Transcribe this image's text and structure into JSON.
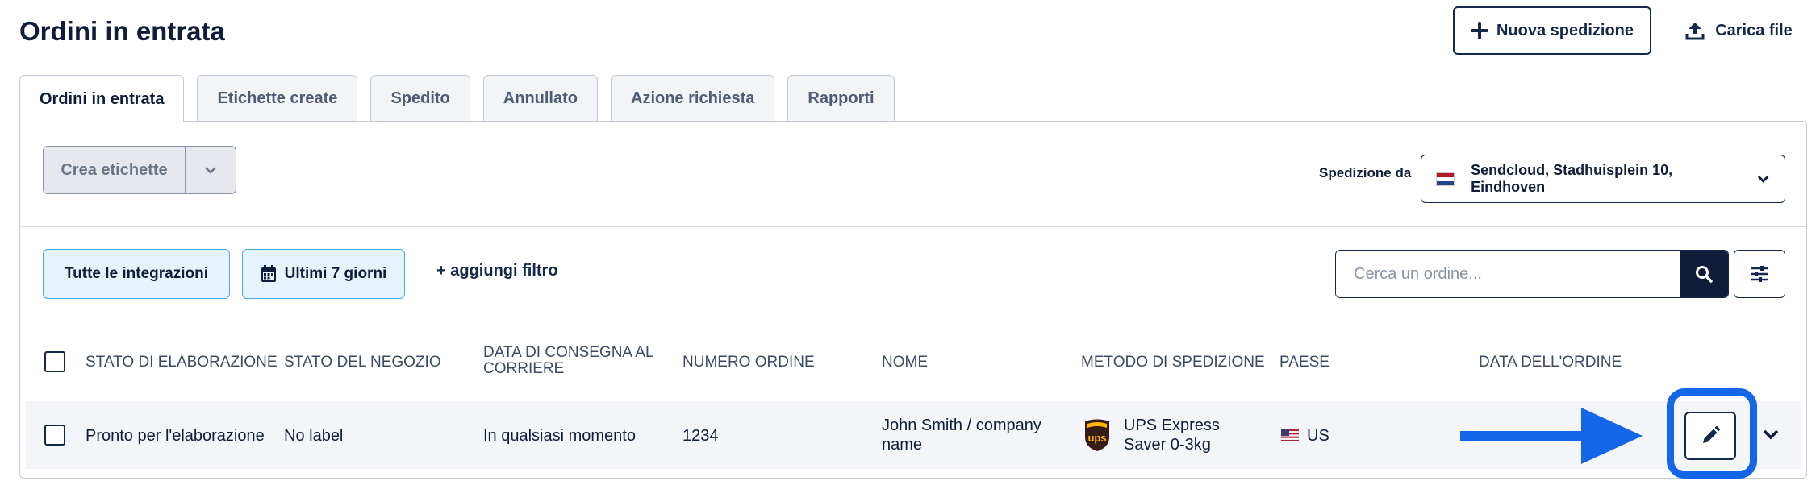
{
  "header": {
    "title": "Ordini in entrata",
    "new_shipment_label": "Nuova spedizione",
    "upload_label": "Carica file"
  },
  "tabs": [
    {
      "label": "Ordini in entrata",
      "active": true
    },
    {
      "label": "Etichette create",
      "active": false
    },
    {
      "label": "Spedito",
      "active": false
    },
    {
      "label": "Annullato",
      "active": false
    },
    {
      "label": "Azione richiesta",
      "active": false
    },
    {
      "label": "Rapporti",
      "active": false
    }
  ],
  "toolbar": {
    "create_labels": "Crea etichette",
    "ship_from_label": "Spedizione da",
    "ship_from_value": "Sendcloud, Stadhuisplein 10, Eindhoven"
  },
  "filters": {
    "integrations": "Tutte le integrazioni",
    "date_range": "Ultimi 7 giorni",
    "add_filter": "+ aggiungi filtro",
    "search_placeholder": "Cerca un ordine..."
  },
  "table": {
    "columns": [
      "STATO DI ELABORAZIONE",
      "STATO DEL NEGOZIO",
      "DATA DI CONSEGNA AL CORRIERE",
      "NUMERO ORDINE",
      "NOME",
      "METODO DI SPEDIZIONE",
      "PAESE",
      "DATA DELL'ORDINE"
    ],
    "rows": [
      {
        "processing_status": "Pronto per l'elaborazione",
        "store_status": "No label",
        "carrier_handover": "In qualsiasi momento",
        "order_number": "1234",
        "name": "John Smith / company name",
        "shipping_method": "UPS Express Saver 0-3kg",
        "carrier_logo_text": "ups",
        "country": "US"
      }
    ]
  },
  "colors": {
    "navy": "#14284b",
    "highlight_blue": "#1466e8",
    "chip_bg": "#e5f3fc",
    "chip_border": "#4aa7e0",
    "ups_brown": "#351c15",
    "ups_gold": "#ffb500"
  },
  "icons": {
    "new_shipment": "plus-icon",
    "upload": "upload-icon",
    "calendar": "calendar-icon",
    "search": "search-icon",
    "settings": "sliders-icon",
    "edit": "pencil-icon",
    "expand": "chevron-down-icon",
    "annotation": "arrow-right-icon"
  }
}
